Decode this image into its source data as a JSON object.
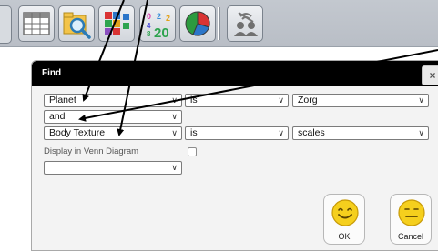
{
  "toolbar": {
    "buttons": [
      {
        "name": "table-icon"
      },
      {
        "name": "search-icon"
      },
      {
        "name": "sort-icon"
      },
      {
        "name": "number-grid-icon",
        "text": "20"
      },
      {
        "name": "pie-chart-icon"
      },
      {
        "name": "people-network-icon"
      }
    ]
  },
  "dialog": {
    "title": "Find",
    "close_label": "×",
    "row1": {
      "field": "Planet",
      "operator": "is",
      "value": "Zorg"
    },
    "connector": "and",
    "row2": {
      "field": "Body Texture",
      "operator": "is",
      "value": "scales"
    },
    "venn_label": "Display in Venn Diagram",
    "venn_checked": false,
    "extra_select": "",
    "ok_label": "OK",
    "cancel_label": "Cancel",
    "chevron": "∨"
  },
  "colors": {
    "titlebar": "#000000",
    "smiley": "#f5cf1d",
    "arrow": "#000000"
  }
}
